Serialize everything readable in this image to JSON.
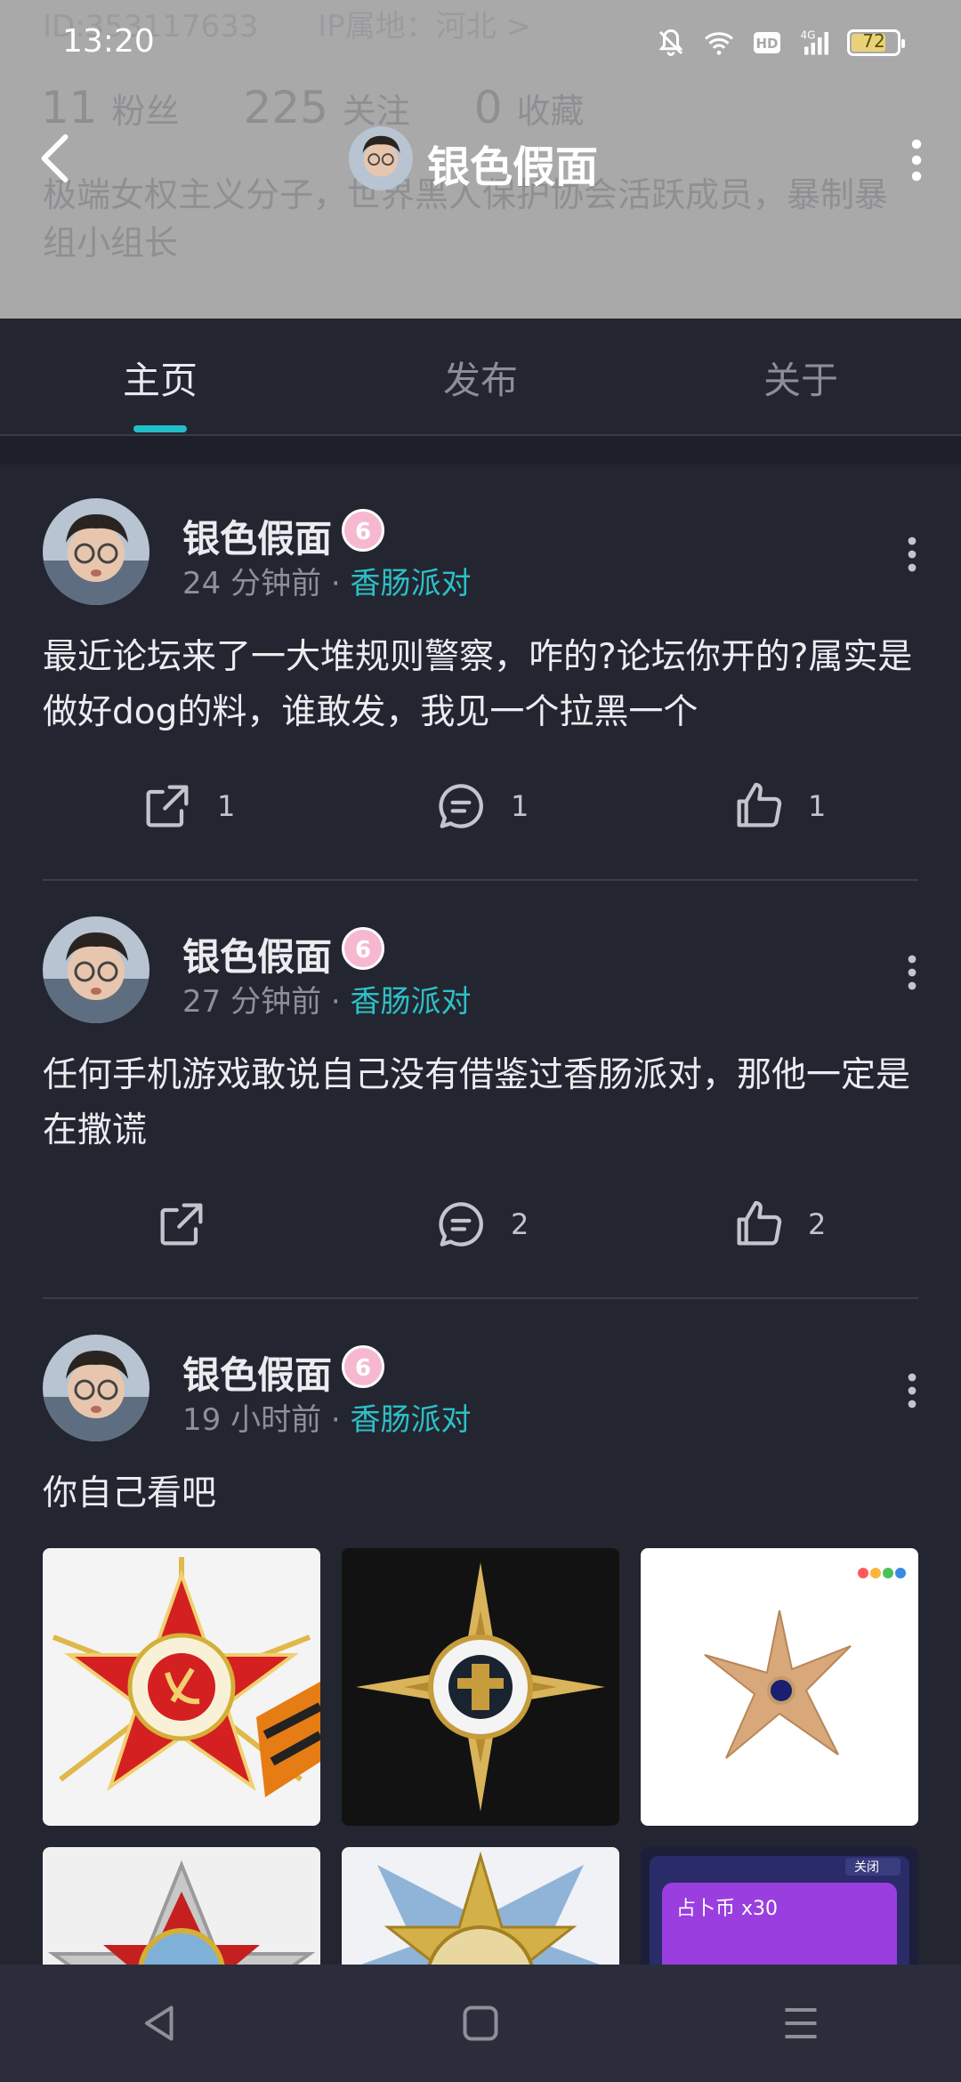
{
  "status": {
    "time": "13:20",
    "battery": "72",
    "hd_label": "HD",
    "net_label": "4G"
  },
  "profile_bg": {
    "id_text": "ID:353117633",
    "ip_text": "IP属地：河北 >",
    "fans_count": "11",
    "fans_label": "粉丝",
    "follow_count": "225",
    "follow_label": "关注",
    "collect_count": "0",
    "collect_label": "收藏",
    "bio": "极端女权主义分子，世界黑人保护协会活跃成员，暴制暴组小组长"
  },
  "header": {
    "title": "银色假面"
  },
  "tabs": [
    {
      "label": "主页"
    },
    {
      "label": "发布"
    },
    {
      "label": "关于"
    }
  ],
  "posts": [
    {
      "author": "银色假面",
      "badge": "6",
      "time": "24 分钟前",
      "sep": " · ",
      "board": "香肠派对",
      "text": "最近论坛来了一大堆规则警察，咋的?论坛你开的?属实是做好dog的料，谁敢发，我见一个拉黑一个",
      "share": "1",
      "comments": "1",
      "likes": "1"
    },
    {
      "author": "银色假面",
      "badge": "6",
      "time": "27 分钟前",
      "sep": " · ",
      "board": "香肠派对",
      "text": "任何手机游戏敢说自己没有借鉴过香肠派对，那他一定是在撒谎",
      "share": "",
      "comments": "2",
      "likes": "2"
    },
    {
      "author": "银色假面",
      "badge": "6",
      "time": "19 小时前",
      "sep": " · ",
      "board": "香肠派对",
      "text": "你自己看吧",
      "images": [
        "order-of-patriotic-war",
        "compass-star-badge",
        "gold-star-brooch",
        "soviet-order-badge",
        "motherland-order-badge",
        "game-screenshot"
      ],
      "img_caption_1": "占卜币 x30",
      "img_caption_2": "关闭"
    }
  ],
  "colors": {
    "accent": "#21c0c8",
    "background": "#232531",
    "header_bg": "#a9a9a9",
    "badge": "#f6b8cf"
  }
}
